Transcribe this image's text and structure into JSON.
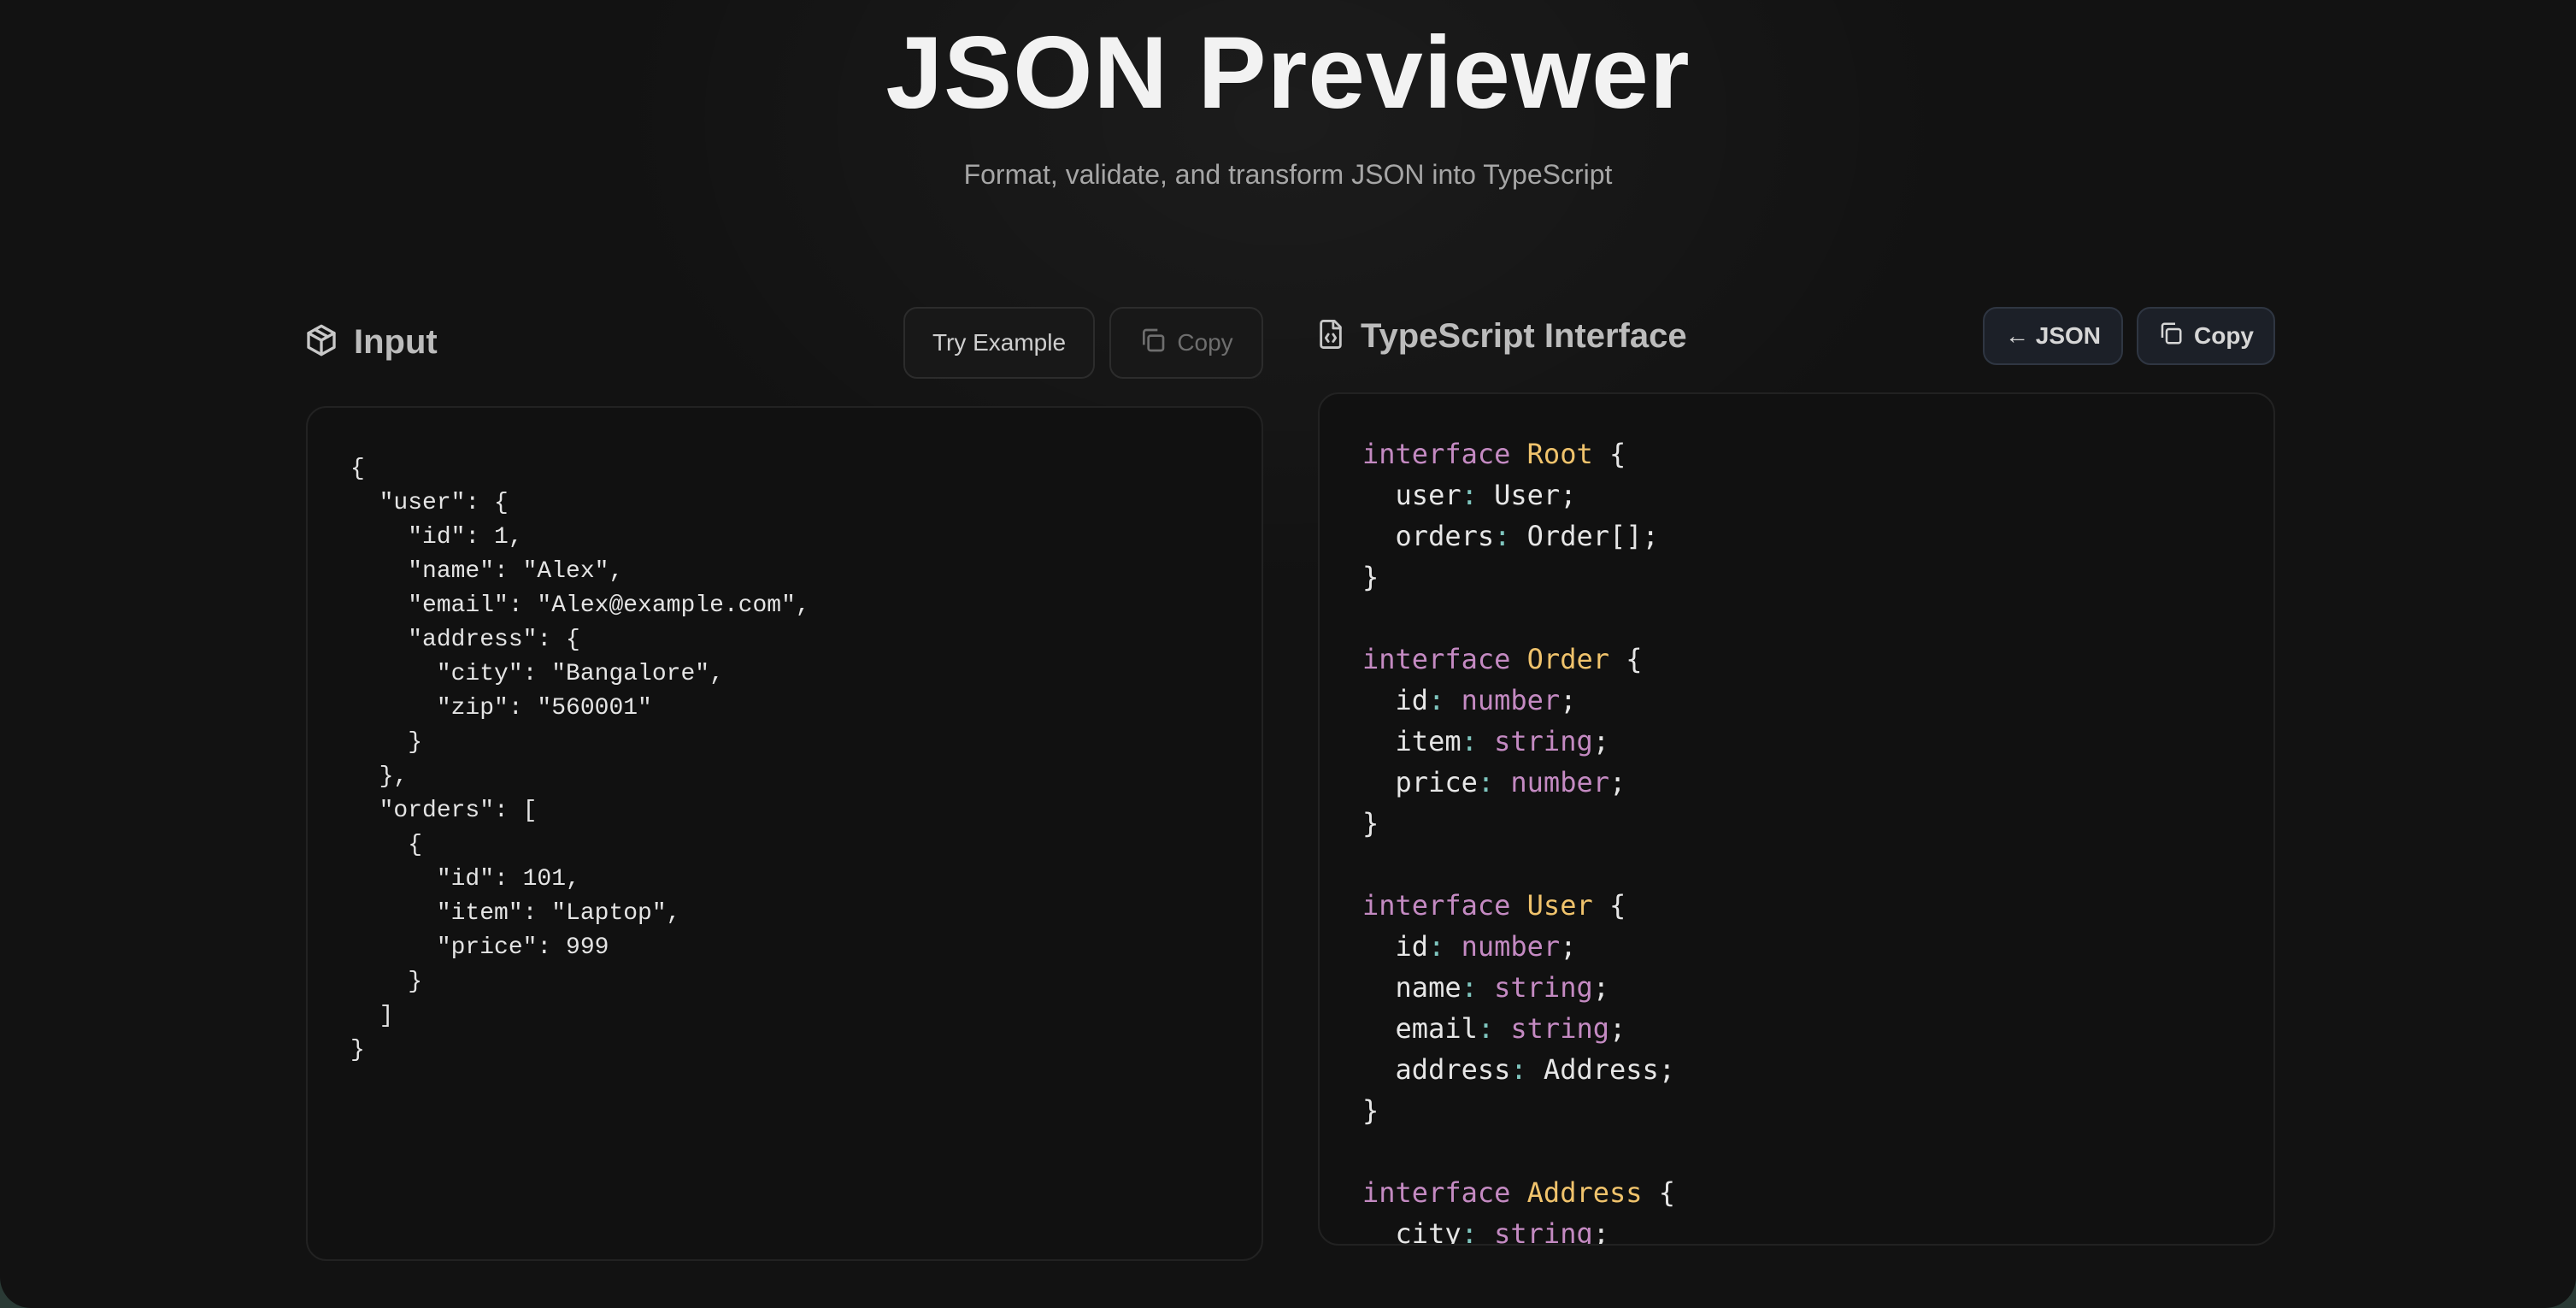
{
  "header": {
    "title": "JSON Previewer",
    "subtitle": "Format, validate, and transform JSON into TypeScript"
  },
  "input_panel": {
    "label": "Input",
    "try_example_label": "Try Example",
    "copy_label": "Copy",
    "icon": "package-icon",
    "json_text": "{\n  \"user\": {\n    \"id\": 1,\n    \"name\": \"Alex\",\n    \"email\": \"Alex@example.com\",\n    \"address\": {\n      \"city\": \"Bangalore\",\n      \"zip\": \"560001\"\n    }\n  },\n  \"orders\": [\n    {\n      \"id\": 101,\n      \"item\": \"Laptop\",\n      \"price\": 999\n    }\n  ]\n}"
  },
  "output_panel": {
    "label": "TypeScript Interface",
    "json_button_label": "← JSON",
    "copy_label": "Copy",
    "icon": "file-code-icon",
    "keyword": "interface",
    "interfaces": [
      {
        "name": "Root",
        "fields": [
          {
            "key": "user",
            "type": "User"
          },
          {
            "key": "orders",
            "type": "Order[]"
          }
        ]
      },
      {
        "name": "Order",
        "fields": [
          {
            "key": "id",
            "type": "number"
          },
          {
            "key": "item",
            "type": "string"
          },
          {
            "key": "price",
            "type": "number"
          }
        ]
      },
      {
        "name": "User",
        "fields": [
          {
            "key": "id",
            "type": "number"
          },
          {
            "key": "name",
            "type": "string"
          },
          {
            "key": "email",
            "type": "string"
          },
          {
            "key": "address",
            "type": "Address"
          }
        ]
      },
      {
        "name": "Address",
        "fields": [
          {
            "key": "city",
            "type": "string"
          }
        ]
      }
    ]
  },
  "colors": {
    "background": "#121212",
    "keyword": "#c48ac2",
    "interface_name": "#f0c36c",
    "colon": "#7fc6bf"
  }
}
